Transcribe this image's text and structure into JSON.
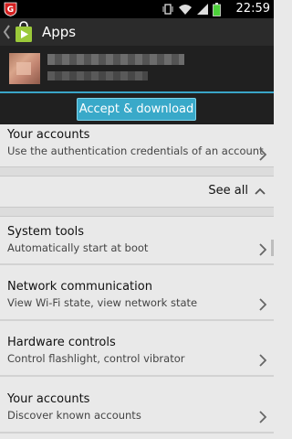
{
  "status_bar": {
    "time": "22:59"
  },
  "action_bar": {
    "title": "Apps"
  },
  "accept_button": {
    "label": "Accept & download"
  },
  "see_all": {
    "label": "See all"
  },
  "permissions_top": {
    "title": "Your accounts",
    "subtitle": "Use the authentication credentials of an account"
  },
  "permissions": [
    {
      "title": "System tools",
      "subtitle": "Automatically start at boot"
    },
    {
      "title": "Network communication",
      "subtitle": "View Wi-Fi state, view network state"
    },
    {
      "title": "Hardware controls",
      "subtitle": "Control flashlight, control vibrator"
    },
    {
      "title": "Your accounts",
      "subtitle": "Discover known accounts"
    }
  ],
  "icons": {
    "status": [
      "g-data-shield-icon",
      "vibrate-icon",
      "wifi-icon",
      "signal-icon",
      "battery-icon"
    ],
    "nav": [
      "back-chevron-icon",
      "play-store-icon"
    ]
  },
  "colors": {
    "accent": "#39a9c9",
    "battery": "#4cd13a"
  }
}
